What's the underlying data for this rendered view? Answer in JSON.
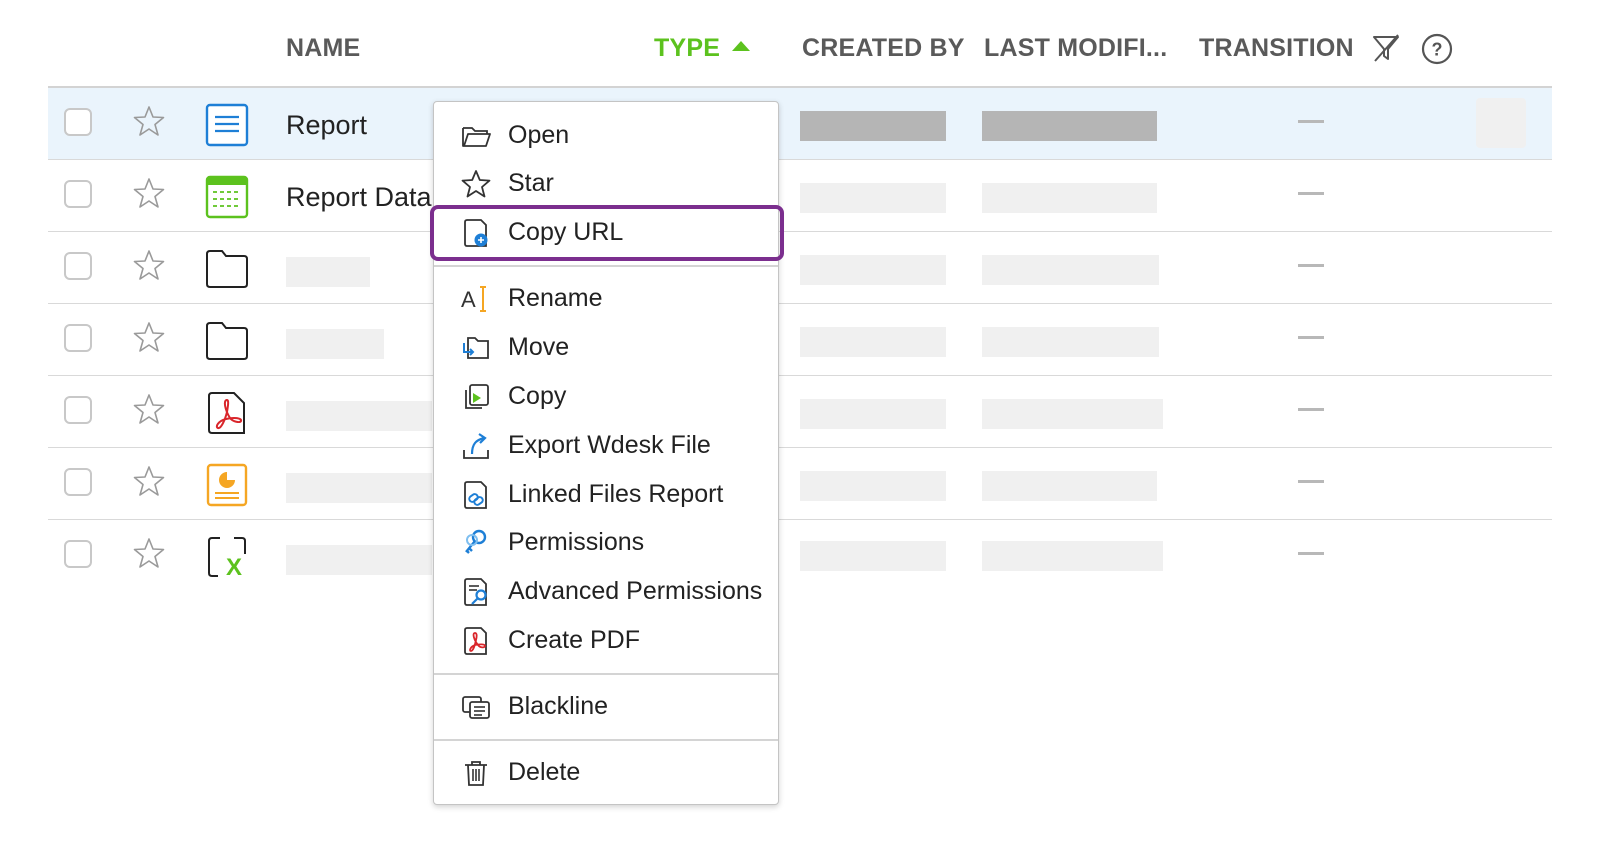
{
  "columns": {
    "name": "NAME",
    "type": "TYPE",
    "created_by": "CREATED BY",
    "last_modified": "LAST MODIFI...",
    "transition": "TRANSITION"
  },
  "header_icons": {
    "filter": "filter-off-icon",
    "help": "help-icon"
  },
  "rows": [
    {
      "name": "Report",
      "icon": "document-icon",
      "transition": "—",
      "selected": true
    },
    {
      "name": "Report Data",
      "icon": "spreadsheet-icon",
      "transition": "—"
    },
    {
      "name": "",
      "icon": "folder-icon",
      "transition": "—"
    },
    {
      "name": "",
      "icon": "folder-icon",
      "transition": "—"
    },
    {
      "name": "",
      "icon": "pdf-icon",
      "transition": "—"
    },
    {
      "name": "",
      "icon": "presentation-icon",
      "transition": "—"
    },
    {
      "name": "",
      "icon": "excel-icon",
      "transition": "—"
    }
  ],
  "context_menu": {
    "items": [
      {
        "label": "Open",
        "icon": "folder-open-icon"
      },
      {
        "label": "Star",
        "icon": "star-icon"
      },
      {
        "label": "Copy URL",
        "icon": "copy-url-icon",
        "highlighted": true
      },
      {
        "label": "Rename",
        "icon": "rename-icon"
      },
      {
        "label": "Move",
        "icon": "move-icon"
      },
      {
        "label": "Copy",
        "icon": "copy-icon"
      },
      {
        "label": "Export Wdesk File",
        "icon": "export-icon"
      },
      {
        "label": "Linked Files Report",
        "icon": "linked-files-icon"
      },
      {
        "label": "Permissions",
        "icon": "permissions-key-icon"
      },
      {
        "label": "Advanced Permissions",
        "icon": "advanced-permissions-icon"
      },
      {
        "label": "Create PDF",
        "icon": "pdf-icon"
      },
      {
        "label": "Blackline",
        "icon": "blackline-icon"
      },
      {
        "label": "Delete",
        "icon": "trash-icon"
      }
    ]
  },
  "colors": {
    "accent_green": "#5cc21e",
    "highlight_purple": "#7b2e8e",
    "selected_row": "#eaf4fc",
    "doc_blue": "#1e7fd6",
    "pdf_red": "#d9262b",
    "presentation_orange": "#f5a623"
  }
}
